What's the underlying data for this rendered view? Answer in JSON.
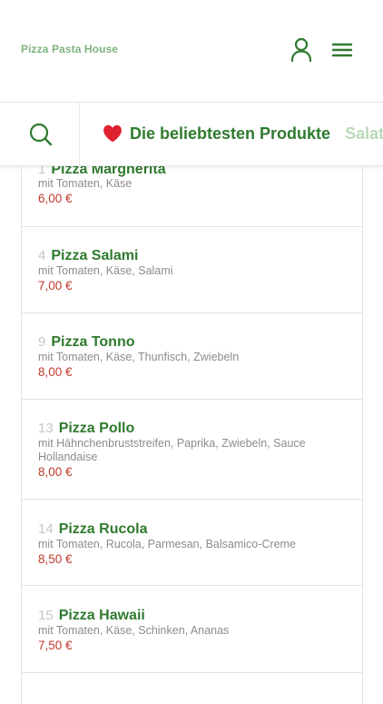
{
  "header": {
    "brand": "Pizza Pasta House",
    "user_icon": "user-icon",
    "menu_icon": "hamburger-menu-icon"
  },
  "categories": {
    "search_icon": "search-icon",
    "items": [
      {
        "label": "Die beliebtesten Produkte",
        "icon": "heart-icon",
        "active": true
      },
      {
        "label": "Salate",
        "active": false
      }
    ]
  },
  "products": [
    {
      "number": "1",
      "name": "Pizza Margherita",
      "description": "mit Tomaten, Käse",
      "price": "6,00 €"
    },
    {
      "number": "4",
      "name": "Pizza Salami",
      "description": "mit Tomaten, Käse, Salami",
      "price": "7,00 €"
    },
    {
      "number": "9",
      "name": "Pizza Tonno",
      "description": "mit Tomaten, Käse, Thunfisch, Zwiebeln",
      "price": "8,00 €"
    },
    {
      "number": "13",
      "name": "Pizza Pollo",
      "description": "mit Hähnchenbruststreifen, Paprika, Zwiebeln, Sauce Hollandaise",
      "price": "8,00 €"
    },
    {
      "number": "14",
      "name": "Pizza Rucola",
      "description": "mit Tomaten, Rucola, Parmesan, Balsamico-Creme",
      "price": "8,50 €"
    },
    {
      "number": "15",
      "name": "Pizza Hawaii",
      "description": "mit Tomaten, Käse, Schinken, Ananas",
      "price": "7,50 €"
    }
  ],
  "colors": {
    "accent": "#2f7a2f",
    "accent_light": "#b9d9b9",
    "brand_text": "#7fb27f",
    "price": "#c0392b",
    "heart": "#e0212f"
  }
}
